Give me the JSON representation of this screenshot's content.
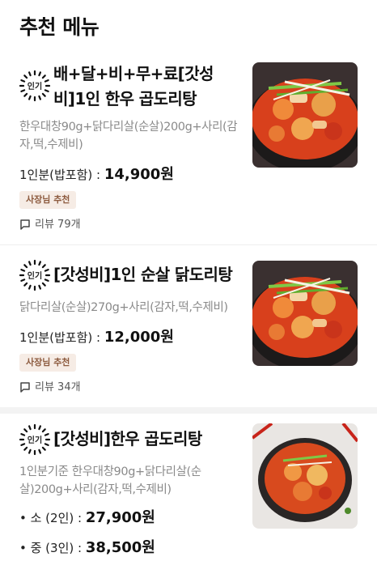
{
  "section_title": "추천 메뉴",
  "badge_label": "인기",
  "owner_tag": "사장님 추천",
  "items": [
    {
      "name": "배+달+비+무+료[갓성비]1인 한우 곱도리탕",
      "description": "한우대창90g+닭다리살(순살)200g+사리(감자,떡,수제비)",
      "portion": "1인분(밥포함) :",
      "price": "14,900원",
      "review": "리뷰 79개",
      "photo_icon": "stew-photo"
    },
    {
      "name": "[갓성비]1인 순살 닭도리탕",
      "description": "닭다리살(순살)270g+사리(감자,떡,수제비)",
      "portion": "1인분(밥포함) :",
      "price": "12,000원",
      "review": "리뷰 34개",
      "photo_icon": "stew-photo"
    },
    {
      "name": "[갓성비]한우 곱도리탕",
      "description": "1인분기준 한우대창90g+닭다리살(순살)200g+사리(감자,떡,수제비)",
      "options": [
        {
          "label": "• 소 (2인) :",
          "price": "27,900원"
        },
        {
          "label": "• 중 (3인) :",
          "price": "38,500원"
        }
      ],
      "photo_icon": "stew-photo"
    }
  ],
  "colors": {
    "owner_tag_bg": "#f6ece5",
    "owner_tag_text": "#8d5b3f",
    "divider": "#f3f3f3"
  }
}
